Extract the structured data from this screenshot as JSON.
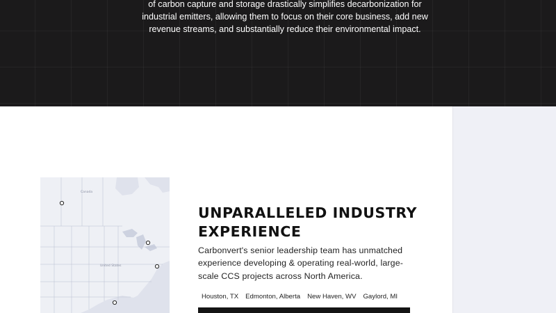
{
  "hero": {
    "description": "of carbon capture and storage drastically simplifies decarbonization for industrial emitters, allowing them to focus on their core business, add new revenue streams, and substantially reduce their environmental impact."
  },
  "experience": {
    "heading": "UNPARALLELED INDUSTRY EXPERIENCE",
    "body": "Carbonvert's senior leadership team has unmatched experience developing & operating real-world, large-scale CCS projects across North America.",
    "locations": [
      "Houston, TX",
      "Edmonton, Alberta",
      "New Haven, WV",
      "Gaylord, MI"
    ]
  },
  "map": {
    "labels": [
      "Canada",
      "United States"
    ]
  },
  "colors": {
    "hero_bg": "#1b1a1b",
    "side_panel_bg": "#eff0f6",
    "map_water": "#dfe2ec",
    "map_land": "#eef0f5",
    "text_dark": "#111111"
  }
}
